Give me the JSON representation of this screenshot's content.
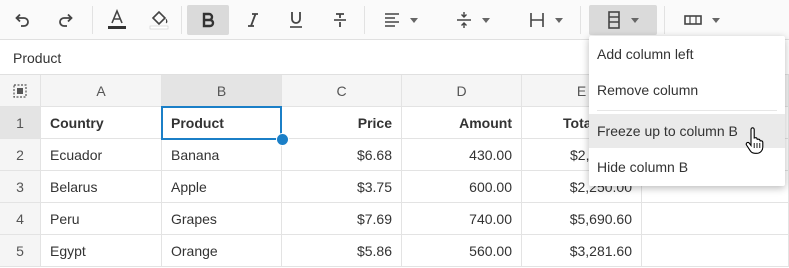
{
  "toolbar": {
    "buttons": [
      {
        "name": "undo-button",
        "icon": "undo-icon"
      },
      {
        "name": "redo-button",
        "icon": "redo-icon"
      },
      {
        "name": "font-color-button",
        "icon": "font-color-icon"
      },
      {
        "name": "fill-color-button",
        "icon": "fill-color-icon"
      },
      {
        "name": "bold-button",
        "icon": "bold-icon",
        "active": true
      },
      {
        "name": "italic-button",
        "icon": "italic-icon"
      },
      {
        "name": "underline-button",
        "icon": "underline-icon"
      },
      {
        "name": "strikethrough-button",
        "icon": "strikethrough-icon"
      },
      {
        "name": "align-horizontal-dropdown",
        "icon": "align-left-icon"
      },
      {
        "name": "align-vertical-dropdown",
        "icon": "align-middle-icon"
      },
      {
        "name": "row-menu-dropdown",
        "icon": "row-icon"
      },
      {
        "name": "column-menu-dropdown",
        "icon": "column-icon",
        "active": true
      },
      {
        "name": "merge-cells-dropdown",
        "icon": "merge-cells-icon"
      }
    ],
    "font_color_hex": "#333333",
    "fill_color_hex": "#ffffff"
  },
  "formula_bar": {
    "value": "Product"
  },
  "grid": {
    "select_all_icon": "select-all-icon",
    "columns": [
      "A",
      "B",
      "C",
      "D",
      "E"
    ],
    "selected_column": "B",
    "rows": [
      {
        "num": "1",
        "cells": [
          "Country",
          "Product",
          "Price",
          "Amount",
          "Tota"
        ]
      },
      {
        "num": "2",
        "cells": [
          "Ecuador",
          "Banana",
          "$6.68",
          "430.00",
          "$2,"
        ]
      },
      {
        "num": "3",
        "cells": [
          "Belarus",
          "Apple",
          "$3.75",
          "600.00",
          "$2,250.00"
        ]
      },
      {
        "num": "4",
        "cells": [
          "Peru",
          "Grapes",
          "$7.69",
          "740.00",
          "$5,690.60"
        ]
      },
      {
        "num": "5",
        "cells": [
          "Egypt",
          "Orange",
          "$5.86",
          "560.00",
          "$3,281.60"
        ]
      }
    ],
    "selected_cell": "B1",
    "selection_color": "#1b7fc7"
  },
  "context_menu": {
    "items": [
      "Add column left",
      "Remove column",
      "Freeze up to column B",
      "Hide column B"
    ],
    "hovered_item": "Freeze up to column B"
  }
}
